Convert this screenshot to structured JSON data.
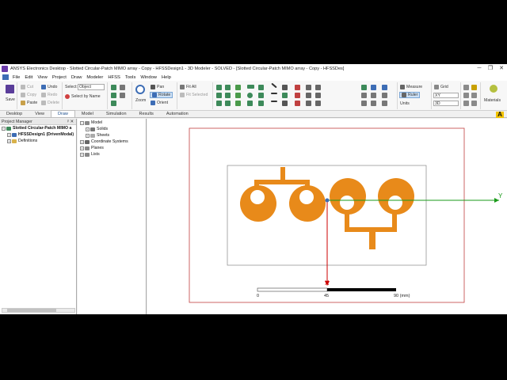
{
  "window": {
    "title": "ANSYS Electronics Desktop - Slotted Circular-Patch MIMO array - Copy - HFSSDesign1 - 3D Modeler - SOLVED - [Slotted Circular-Patch MIMO array - Copy - HFSSDes]",
    "min": "─",
    "restore": "❐",
    "close": "✕"
  },
  "menu": [
    "File",
    "Edit",
    "View",
    "Project",
    "Draw",
    "Modeler",
    "HFSS",
    "Tools",
    "Window",
    "Help"
  ],
  "ribbon": {
    "save": "Save",
    "cut": "Cut",
    "copy": "Copy",
    "paste": "Paste",
    "undo": "Undo",
    "redo": "Redo",
    "delete": "Delete",
    "select_label": "Select:",
    "select_value": "Object",
    "select_by_name": "Select by Name",
    "zoom": "Zoom",
    "pan": "Pan",
    "rotate": "Rotate",
    "orient": "Orient",
    "fit_all": "Fit All",
    "fit_selected": "Fit Selected",
    "measure": "Measure",
    "ruler": "Ruler",
    "units": "Units",
    "grid": "Grid",
    "plane": "XY",
    "view_mode": "3D",
    "materials": "Materials"
  },
  "tabs": [
    "Desktop",
    "View",
    "Draw",
    "Model",
    "Simulation",
    "Results",
    "Automation"
  ],
  "active_tab": "Draw",
  "project_manager": {
    "header": "Project Manager",
    "pin": "ᵖ ✕",
    "project": "Slotted Circular-Patch MIMO a",
    "design": "HFSSDesign1 (DrivenModal)",
    "definitions": "Definitions"
  },
  "model_tree": {
    "model": "Model",
    "solids": "Solids",
    "sheets": "Sheets",
    "coordinate_systems": "Coordinate Systems",
    "planes": "Planes",
    "lists": "Lists"
  },
  "viewport": {
    "axis_y": "Y",
    "axis_x": "X",
    "scale": {
      "ticks": [
        "0",
        "45",
        "90 (mm)"
      ]
    }
  },
  "colors": {
    "patch": "#e88a1a",
    "axis_y": "#1a9a1a",
    "axis_x": "#cc0000",
    "boundary": "#c04040",
    "accent": "#1a4d8c"
  },
  "ansys_logo": "A"
}
